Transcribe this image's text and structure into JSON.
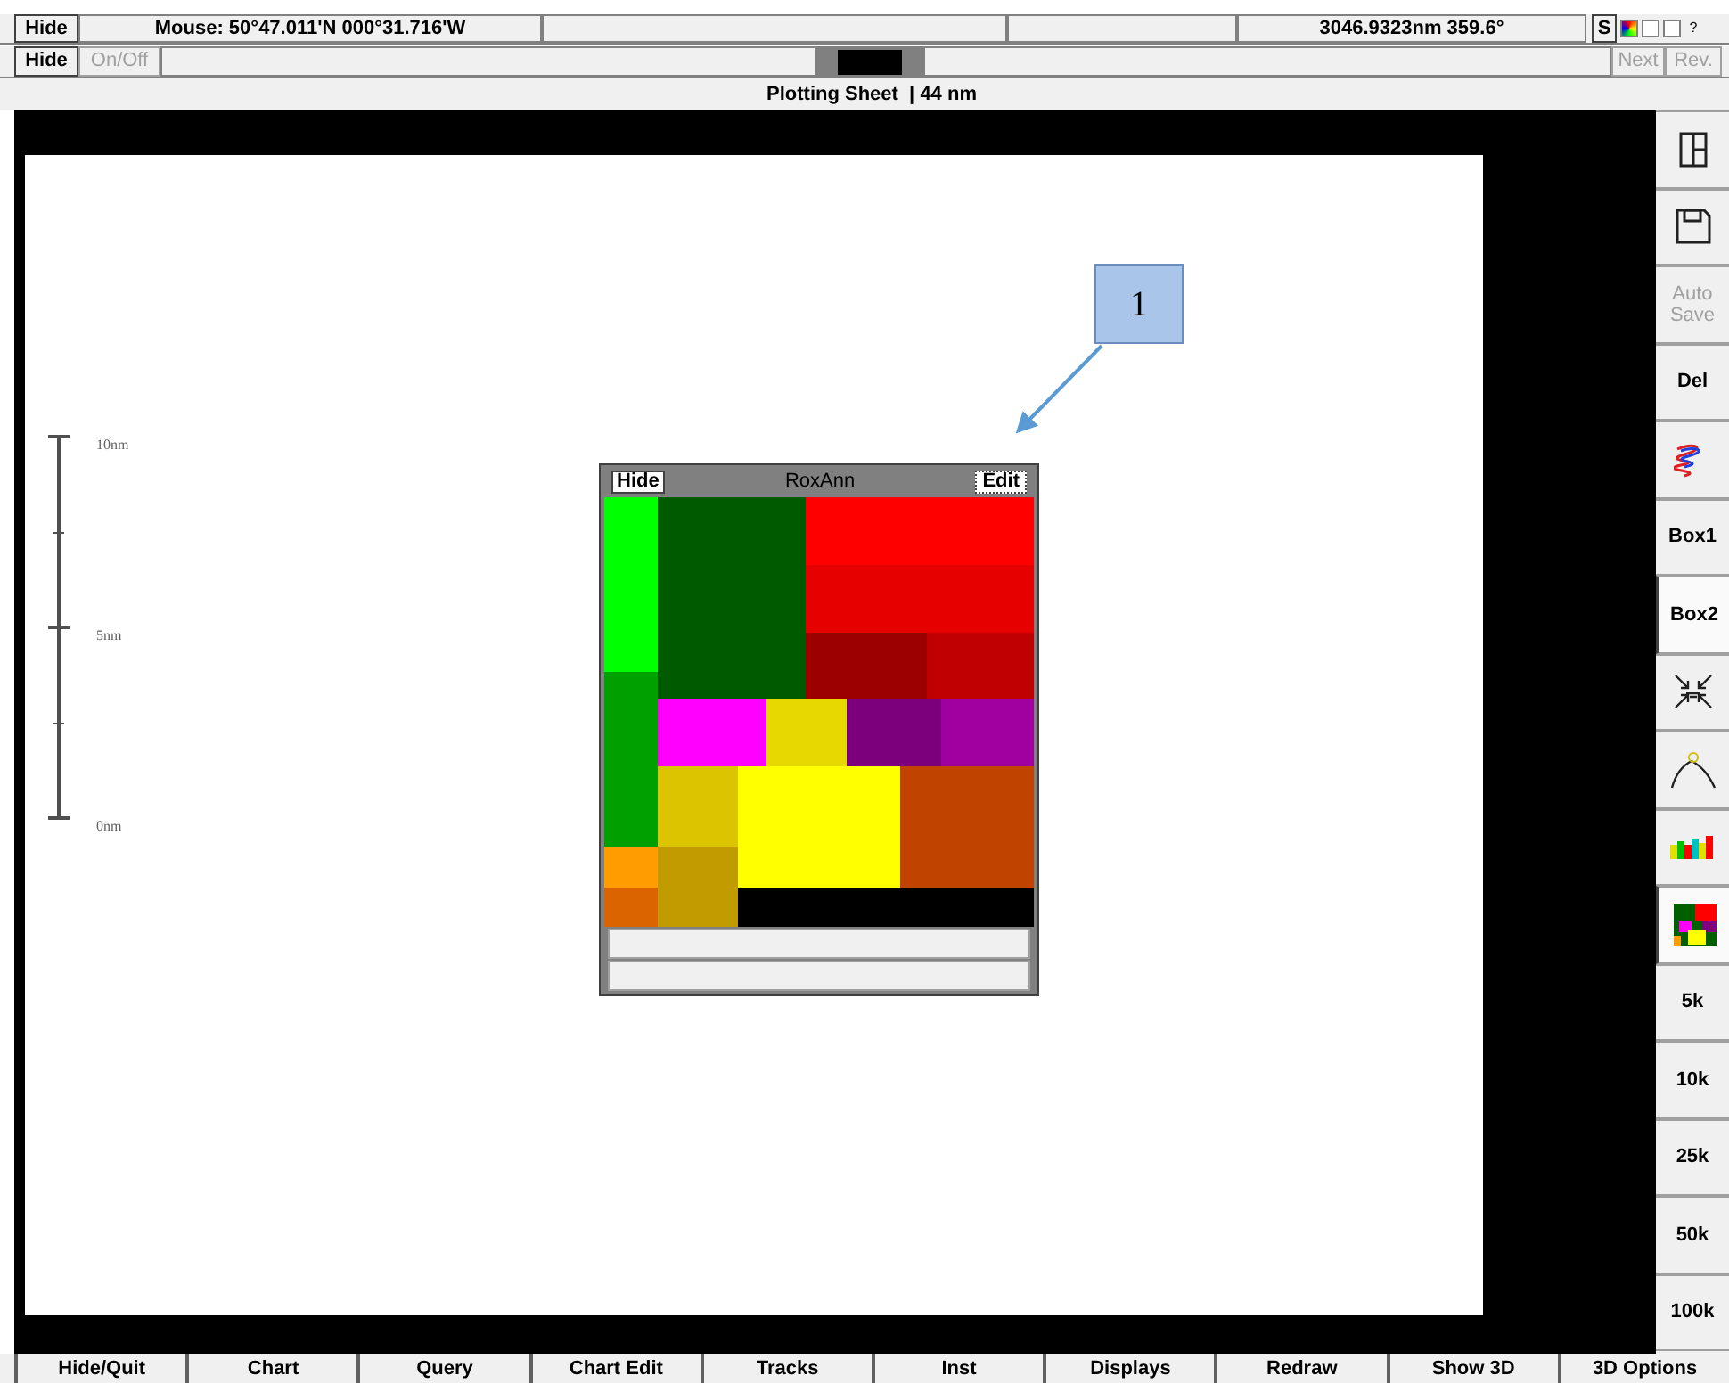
{
  "top_bar": {
    "hide_button": "Hide",
    "mouse_position": "Mouse: 50°47.011'N 000°31.716'W",
    "range_bearing": "3046.9323nm 359.6°",
    "s_button": "S",
    "help_button": "?"
  },
  "second_bar": {
    "hide_button": "Hide",
    "onoff_button": {
      "label": "On/Off",
      "disabled": true
    },
    "next_button": {
      "label": "Next",
      "disabled": true
    },
    "rev_button": {
      "label": "Rev.",
      "disabled": true
    }
  },
  "sheet_title": "Plotting Sheet  | 44 nm",
  "scale_bar": {
    "labels": [
      "10nm",
      "5nm",
      "0nm"
    ]
  },
  "callout": {
    "label": "1"
  },
  "roxann_panel": {
    "title": "RoxAnn",
    "hide_button": "Hide",
    "edit_button": "Edit",
    "cells": [
      {
        "color": "#00ff00"
      },
      {
        "color": "#005a00"
      },
      {
        "color": "#ff0000"
      },
      {
        "color": "#e60000"
      },
      {
        "color": "#9c0000"
      },
      {
        "color": "#c00000"
      },
      {
        "color": "#00a000"
      },
      {
        "color": "#ff00ff"
      },
      {
        "color": "#e6d800"
      },
      {
        "color": "#7c007c"
      },
      {
        "color": "#a000a0"
      },
      {
        "color": "#dcc400"
      },
      {
        "color": "#ffff00"
      },
      {
        "color": "#c04400"
      },
      {
        "color": "#ff9c00"
      },
      {
        "color": "#dc6400"
      },
      {
        "color": "#c09c00"
      },
      {
        "color": "#000000"
      }
    ]
  },
  "right_toolbar": [
    {
      "kind": "icon",
      "disabled": false,
      "selected": false
    },
    {
      "kind": "icon",
      "disabled": false,
      "selected": false
    },
    {
      "kind": "text",
      "label": "Auto Save",
      "disabled": true,
      "selected": false
    },
    {
      "kind": "text",
      "label": "Del",
      "disabled": false,
      "selected": false
    },
    {
      "kind": "icon",
      "disabled": false,
      "selected": false
    },
    {
      "kind": "text",
      "label": "Box1",
      "disabled": false,
      "selected": false
    },
    {
      "kind": "text",
      "label": "Box2",
      "disabled": false,
      "selected": true
    },
    {
      "kind": "icon",
      "disabled": false,
      "selected": false
    },
    {
      "kind": "icon",
      "disabled": false,
      "selected": false
    },
    {
      "kind": "icon",
      "disabled": false,
      "selected": false
    },
    {
      "kind": "icon",
      "disabled": false,
      "selected": true
    },
    {
      "kind": "text",
      "label": "5k",
      "disabled": false,
      "selected": false
    },
    {
      "kind": "text",
      "label": "10k",
      "disabled": false,
      "selected": false
    },
    {
      "kind": "text",
      "label": "25k",
      "disabled": false,
      "selected": false
    },
    {
      "kind": "text",
      "label": "50k",
      "disabled": false,
      "selected": false
    },
    {
      "kind": "text",
      "label": "100k",
      "disabled": false,
      "selected": false
    }
  ],
  "bottom_bar": [
    "Hide/Quit",
    "Chart",
    "Query",
    "Chart Edit",
    "Tracks",
    "Inst",
    "Displays",
    "Redraw",
    "Show 3D",
    "3D Options"
  ]
}
